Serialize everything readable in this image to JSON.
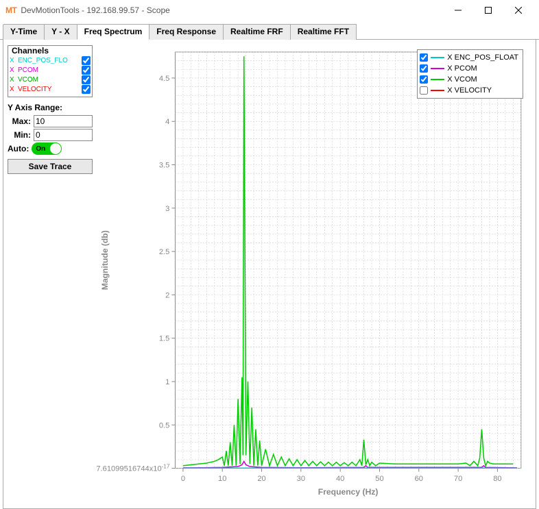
{
  "window": {
    "app_icon": "MT",
    "title": "DevMotionTools - 192.168.99.57 - Scope"
  },
  "tabs": {
    "items": [
      "Y-Time",
      "Y - X",
      "Freq Spectrum",
      "Freq Response",
      "Realtime FRF",
      "Realtime FFT"
    ],
    "active_index": 2
  },
  "sidebar": {
    "channels_title": "Channels",
    "channels": [
      {
        "color": "#00c8c8",
        "label": "ENC_POS_FLO",
        "checked": true
      },
      {
        "color": "#d000d0",
        "label": "PCOM",
        "checked": true
      },
      {
        "color": "#00a000",
        "label": "VCOM",
        "checked": true
      },
      {
        "color": "#ff0000",
        "label": "VELOCITY",
        "checked": true
      }
    ],
    "range_title": "Y Axis Range:",
    "max_label": "Max:",
    "max_value": "10",
    "min_label": "Min:",
    "min_value": "0",
    "auto_label": "Auto:",
    "auto_state": "On",
    "save_label": "Save Trace"
  },
  "legend": {
    "items": [
      {
        "color": "#00c8c8",
        "label": "X ENC_POS_FLOAT",
        "checked": true
      },
      {
        "color": "#d000d0",
        "label": "X PCOM",
        "checked": true
      },
      {
        "color": "#00cc00",
        "label": "X VCOM",
        "checked": true
      },
      {
        "color": "#ff0000",
        "label": "X VELOCITY",
        "checked": false
      }
    ]
  },
  "chart_data": {
    "type": "line",
    "xlabel": "Frequency (Hz)",
    "ylabel": "Magnitude (db)",
    "xticks": [
      0,
      10,
      20,
      30,
      40,
      50,
      60,
      70,
      80
    ],
    "yticks_major": [
      0,
      0.5,
      1,
      1.5,
      2,
      2.5,
      3,
      3.5,
      4,
      4.5
    ],
    "ymin_label": "7.61099516744x10",
    "ymin_exp": "-17",
    "ylim": [
      0,
      4.8
    ],
    "xlim": [
      -2,
      86
    ],
    "series": [
      {
        "name": "X VCOM",
        "color": "#00cc00",
        "x": [
          0,
          1,
          2,
          3,
          4,
          5,
          6,
          7,
          8,
          9,
          10,
          10.5,
          11,
          11.5,
          12,
          12.5,
          13,
          13.5,
          14,
          14.5,
          15,
          15.25,
          15.5,
          16,
          16.5,
          17,
          17.5,
          18,
          18.5,
          19,
          19.5,
          20,
          21,
          22,
          23,
          24,
          25,
          26,
          27,
          28,
          29,
          30,
          31,
          32,
          33,
          34,
          35,
          36,
          37,
          38,
          39,
          40,
          41,
          42,
          43,
          44,
          45,
          45.5,
          46,
          46.5,
          47,
          47.5,
          48,
          49,
          50,
          52,
          54,
          56,
          58,
          60,
          62,
          64,
          66,
          68,
          70,
          72,
          73,
          74,
          75,
          75.5,
          76,
          76.5,
          77,
          77.5,
          78,
          79,
          80,
          81,
          82,
          83,
          84,
          85
        ],
        "values": [
          0.03,
          0.035,
          0.04,
          0.045,
          0.05,
          0.055,
          0.06,
          0.07,
          0.08,
          0.1,
          0.13,
          0.03,
          0.2,
          0.03,
          0.3,
          0.03,
          0.5,
          0.03,
          0.8,
          0.05,
          1.05,
          0.15,
          4.75,
          0.15,
          1.0,
          0.05,
          0.7,
          0.03,
          0.45,
          0.03,
          0.32,
          0.03,
          0.22,
          0.03,
          0.16,
          0.03,
          0.13,
          0.03,
          0.11,
          0.03,
          0.1,
          0.03,
          0.09,
          0.03,
          0.08,
          0.03,
          0.075,
          0.03,
          0.07,
          0.03,
          0.07,
          0.03,
          0.065,
          0.03,
          0.07,
          0.03,
          0.1,
          0.03,
          0.33,
          0.04,
          0.1,
          0.03,
          0.07,
          0.03,
          0.06,
          0.055,
          0.05,
          0.05,
          0.05,
          0.05,
          0.05,
          0.05,
          0.05,
          0.05,
          0.05,
          0.06,
          0.03,
          0.08,
          0.03,
          0.12,
          0.45,
          0.12,
          0.03,
          0.08,
          0.06,
          0.05,
          0.05,
          0.05,
          0.05,
          0.05,
          0.05
        ]
      },
      {
        "name": "X PCOM",
        "color": "#d000d0",
        "x": [
          0,
          5,
          10,
          14,
          15,
          15.5,
          16,
          17,
          20,
          30,
          46,
          46.5,
          47,
          76,
          76.5,
          77,
          85
        ],
        "values": [
          0.005,
          0.006,
          0.01,
          0.02,
          0.04,
          0.08,
          0.04,
          0.02,
          0.01,
          0.006,
          0.01,
          0.03,
          0.01,
          0.01,
          0.03,
          0.01,
          0.005
        ]
      },
      {
        "name": "X ENC_POS_FLOAT",
        "color": "#00c8c8",
        "x": [
          0,
          85
        ],
        "values": [
          0.002,
          0.002
        ]
      }
    ]
  }
}
